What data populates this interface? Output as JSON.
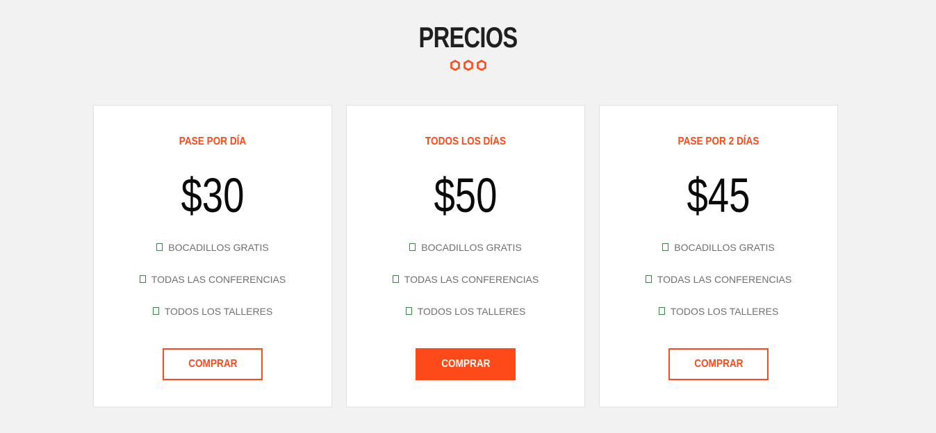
{
  "section": {
    "title": "PRECIOS"
  },
  "accent_color": "#fe4918",
  "plans": [
    {
      "name": "PASE POR DÍA",
      "price": "$30",
      "features": [
        "BOCADILLOS GRATIS",
        "TODAS LAS CONFERENCIAS",
        "TODOS LOS TALLERES"
      ],
      "button_label": "COMPRAR",
      "featured": false
    },
    {
      "name": "TODOS LOS DÍAS",
      "price": "$50",
      "features": [
        "BOCADILLOS GRATIS",
        "TODAS LAS CONFERENCIAS",
        "TODOS LOS TALLERES"
      ],
      "button_label": "COMPRAR",
      "featured": true
    },
    {
      "name": "PASE POR 2 DÍAS",
      "price": "$45",
      "features": [
        "BOCADILLOS GRATIS",
        "TODAS LAS CONFERENCIAS",
        "TODOS LOS TALLERES"
      ],
      "button_label": "COMPRAR",
      "featured": false
    }
  ],
  "icons": {
    "divider": "hexagon-icon",
    "feature": "check-icon"
  }
}
